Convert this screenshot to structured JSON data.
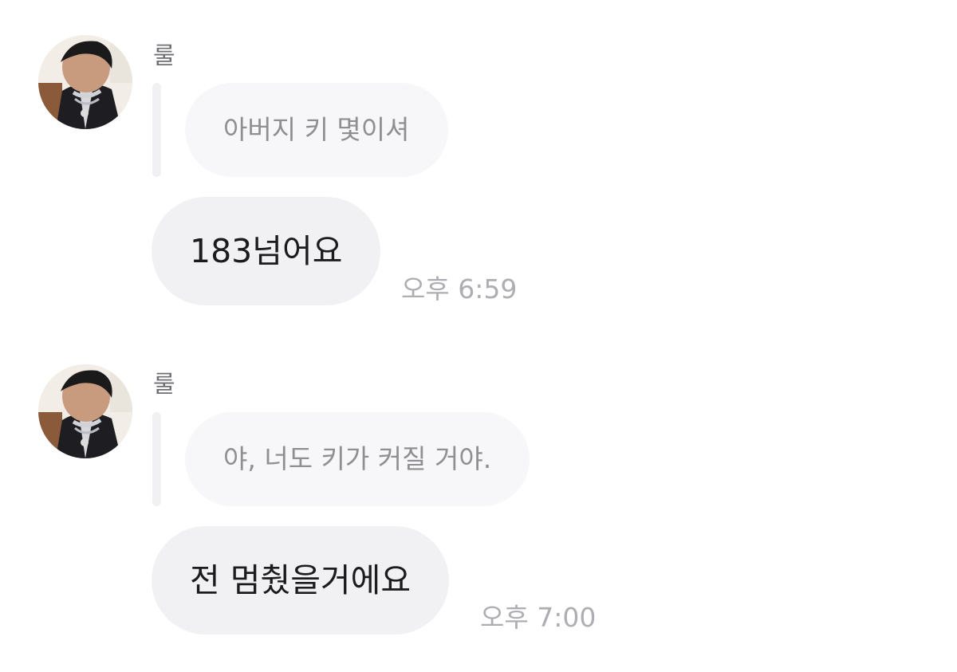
{
  "chat": {
    "messages": [
      {
        "sender": "룰",
        "avatar_icon": "profile-photo",
        "quoted_text": "아버지 키 몇이셔",
        "text": "183넘어요",
        "time": "오후 6:59"
      },
      {
        "sender": "룰",
        "avatar_icon": "profile-photo",
        "quoted_text": "야, 너도 키가 커질 거야.",
        "text": "전 멈췄을거에요",
        "time": "오후 7:00"
      }
    ]
  },
  "colors": {
    "background": "#ffffff",
    "quote_bubble": "#f7f7f9",
    "message_bubble": "#f1f1f4",
    "timestamp": "#aeaeb2"
  }
}
